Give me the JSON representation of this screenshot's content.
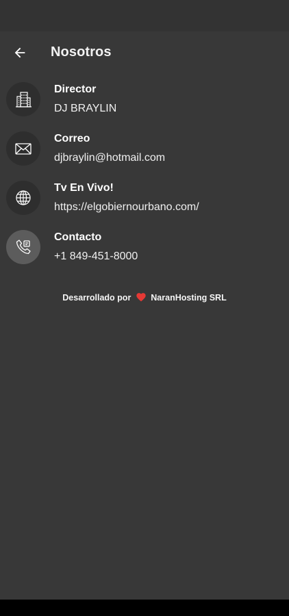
{
  "app_bar": {
    "title": "Nosotros",
    "back_icon": "arrow-left-icon"
  },
  "items": [
    {
      "label": "Director",
      "value": "DJ BRAYLIN",
      "icon": "building-icon"
    },
    {
      "label": "Correo",
      "value": "djbraylin@hotmail.com",
      "icon": "mail-icon"
    },
    {
      "label": "Tv En Vivo!",
      "value": "https://elgobiernourbano.com/",
      "icon": "globe-icon"
    },
    {
      "label": "Contacto",
      "value": "+1 849-451-8000",
      "icon": "phone-icon"
    }
  ],
  "footer": {
    "prefix": "Desarrollado por",
    "brand": "NaranHosting SRL",
    "heart_icon": "heart-icon",
    "heart_color": "#e53935"
  },
  "colors": {
    "background": "#383838",
    "status_bar": "#333333",
    "icon_circle": "#2e2e2e",
    "icon_circle_active": "#5c5c5c"
  }
}
